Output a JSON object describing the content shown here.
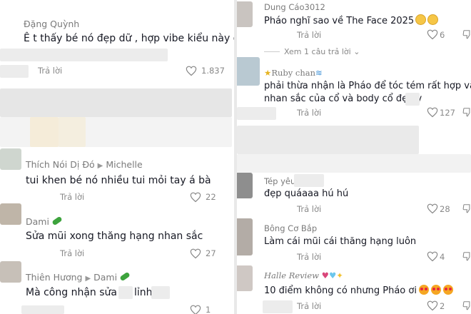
{
  "left": {
    "c1": {
      "user": "Đặng Quỳnh",
      "text": "Ê t thấy bé nó đẹp dữ , hợp vibe kiểu này ghê",
      "reply": "Trả lời",
      "likes": "1.837"
    },
    "c2": {
      "user": "Thích Nói Dị Đó",
      "reply_to": "Michelle",
      "text": "tui khen bé nó nhiều tui mỏi tay á bà",
      "reply": "Trả lời",
      "likes": "22"
    },
    "c3": {
      "user": "Dami",
      "text": "Sửa mũi xong thăng hạng nhan sắc",
      "reply": "Trả lời",
      "likes": "27"
    },
    "c4": {
      "user": "Thiên Hương",
      "reply_to": "Dami",
      "text_a": "Mà công nhận sửa",
      "text_b": "lỉnh",
      "likes": "1"
    }
  },
  "right": {
    "c1": {
      "user": "Dung Cáo3012",
      "text": "Pháo nghĩ sao về The Face 2025",
      "reply": "Trả lời",
      "likes": "6"
    },
    "view_replies": "Xem 1 câu trả lời",
    "c2": {
      "user": "Ruby chan",
      "text1": "phải thừa nhận là Pháo để tóc tém rất hợp và tôn",
      "text2": "nhan sắc của cổ và body cổ đẹp v",
      "reply": "Trả lời",
      "likes": "127"
    },
    "c3": {
      "user": "Tép yêu",
      "text": "đẹp quáaaa hú hú",
      "reply": "Trả lời",
      "likes": "28"
    },
    "c4": {
      "user": "Bông Cơ Bắp",
      "text": "Làm cái mũi cái thăng hạng luôn",
      "reply": "Trả lời",
      "likes": "4"
    },
    "c5": {
      "user": "Halle Review",
      "text": "10 điểm không có nhưng Pháo ơi",
      "reply": "Trả lời",
      "likes": "2"
    }
  },
  "icons": {
    "like": "heart-outline-icon",
    "dislike": "thumbs-down-icon",
    "arrow": "play-arrow-icon"
  }
}
